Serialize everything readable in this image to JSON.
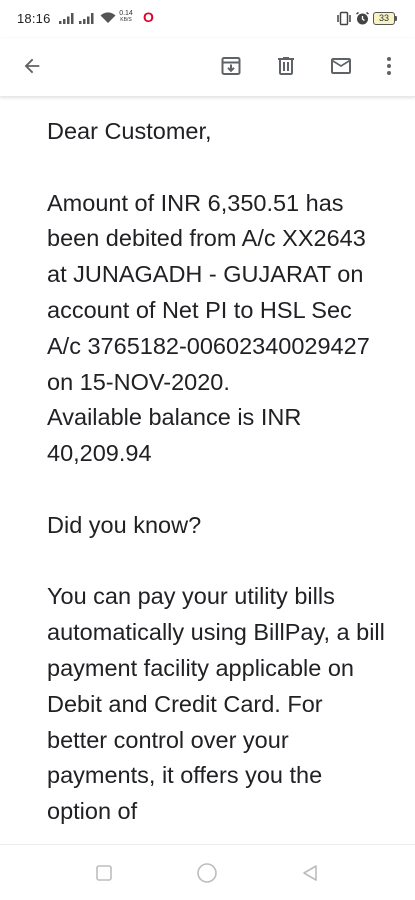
{
  "status_bar": {
    "time": "18:16",
    "network_speed_value": "0.14",
    "network_speed_unit": "KB/S",
    "battery_level": "33",
    "icons": [
      "signal-icon",
      "signal-icon",
      "wifi-icon",
      "opera-icon",
      "vibrate-icon",
      "alarm-icon",
      "battery-icon"
    ]
  },
  "toolbar": {
    "icons": [
      "back-arrow-icon",
      "archive-icon",
      "delete-icon",
      "mail-icon",
      "more-vert-icon"
    ]
  },
  "email": {
    "body": "Dear Customer,\n\nAmount of INR 6,350.51 has been debited from A/c XX2643 at JUNAGADH - GUJARAT on account of Net PI to HSL Sec A/c 3765182-00602340029427 on 15-NOV-2020.\nAvailable balance is INR 40,209.94\n\nDid you know?\n\nYou can pay your utility bills automatically using BillPay, a bill payment facility applicable on Debit and Credit Card. For better control over your payments, it offers you the option of"
  },
  "nav_bar": {
    "icons": [
      "recents-icon",
      "home-icon",
      "back-icon"
    ]
  },
  "colors": {
    "text": "#202124",
    "icon": "#5f6368",
    "opera_red": "#e0002a"
  }
}
